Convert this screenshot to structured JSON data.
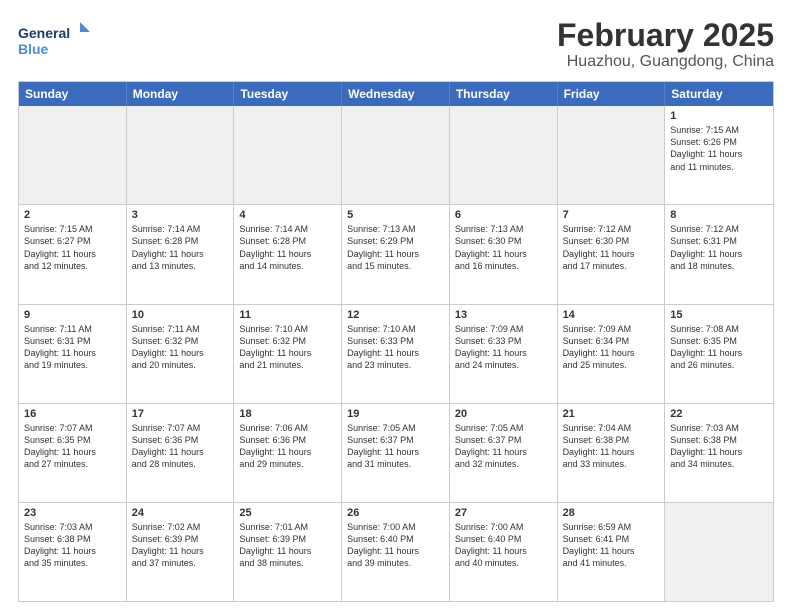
{
  "header": {
    "logo_line1": "General",
    "logo_line2": "Blue",
    "title": "February 2025",
    "subtitle": "Huazhou, Guangdong, China"
  },
  "days_of_week": [
    "Sunday",
    "Monday",
    "Tuesday",
    "Wednesday",
    "Thursday",
    "Friday",
    "Saturday"
  ],
  "weeks": [
    [
      {
        "day": "",
        "text": "",
        "shaded": true
      },
      {
        "day": "",
        "text": "",
        "shaded": true
      },
      {
        "day": "",
        "text": "",
        "shaded": true
      },
      {
        "day": "",
        "text": "",
        "shaded": true
      },
      {
        "day": "",
        "text": "",
        "shaded": true
      },
      {
        "day": "",
        "text": "",
        "shaded": true
      },
      {
        "day": "1",
        "text": "Sunrise: 7:15 AM\nSunset: 6:26 PM\nDaylight: 11 hours\nand 11 minutes.",
        "shaded": false
      }
    ],
    [
      {
        "day": "2",
        "text": "Sunrise: 7:15 AM\nSunset: 6:27 PM\nDaylight: 11 hours\nand 12 minutes.",
        "shaded": false
      },
      {
        "day": "3",
        "text": "Sunrise: 7:14 AM\nSunset: 6:28 PM\nDaylight: 11 hours\nand 13 minutes.",
        "shaded": false
      },
      {
        "day": "4",
        "text": "Sunrise: 7:14 AM\nSunset: 6:28 PM\nDaylight: 11 hours\nand 14 minutes.",
        "shaded": false
      },
      {
        "day": "5",
        "text": "Sunrise: 7:13 AM\nSunset: 6:29 PM\nDaylight: 11 hours\nand 15 minutes.",
        "shaded": false
      },
      {
        "day": "6",
        "text": "Sunrise: 7:13 AM\nSunset: 6:30 PM\nDaylight: 11 hours\nand 16 minutes.",
        "shaded": false
      },
      {
        "day": "7",
        "text": "Sunrise: 7:12 AM\nSunset: 6:30 PM\nDaylight: 11 hours\nand 17 minutes.",
        "shaded": false
      },
      {
        "day": "8",
        "text": "Sunrise: 7:12 AM\nSunset: 6:31 PM\nDaylight: 11 hours\nand 18 minutes.",
        "shaded": false
      }
    ],
    [
      {
        "day": "9",
        "text": "Sunrise: 7:11 AM\nSunset: 6:31 PM\nDaylight: 11 hours\nand 19 minutes.",
        "shaded": false
      },
      {
        "day": "10",
        "text": "Sunrise: 7:11 AM\nSunset: 6:32 PM\nDaylight: 11 hours\nand 20 minutes.",
        "shaded": false
      },
      {
        "day": "11",
        "text": "Sunrise: 7:10 AM\nSunset: 6:32 PM\nDaylight: 11 hours\nand 21 minutes.",
        "shaded": false
      },
      {
        "day": "12",
        "text": "Sunrise: 7:10 AM\nSunset: 6:33 PM\nDaylight: 11 hours\nand 23 minutes.",
        "shaded": false
      },
      {
        "day": "13",
        "text": "Sunrise: 7:09 AM\nSunset: 6:33 PM\nDaylight: 11 hours\nand 24 minutes.",
        "shaded": false
      },
      {
        "day": "14",
        "text": "Sunrise: 7:09 AM\nSunset: 6:34 PM\nDaylight: 11 hours\nand 25 minutes.",
        "shaded": false
      },
      {
        "day": "15",
        "text": "Sunrise: 7:08 AM\nSunset: 6:35 PM\nDaylight: 11 hours\nand 26 minutes.",
        "shaded": false
      }
    ],
    [
      {
        "day": "16",
        "text": "Sunrise: 7:07 AM\nSunset: 6:35 PM\nDaylight: 11 hours\nand 27 minutes.",
        "shaded": false
      },
      {
        "day": "17",
        "text": "Sunrise: 7:07 AM\nSunset: 6:36 PM\nDaylight: 11 hours\nand 28 minutes.",
        "shaded": false
      },
      {
        "day": "18",
        "text": "Sunrise: 7:06 AM\nSunset: 6:36 PM\nDaylight: 11 hours\nand 29 minutes.",
        "shaded": false
      },
      {
        "day": "19",
        "text": "Sunrise: 7:05 AM\nSunset: 6:37 PM\nDaylight: 11 hours\nand 31 minutes.",
        "shaded": false
      },
      {
        "day": "20",
        "text": "Sunrise: 7:05 AM\nSunset: 6:37 PM\nDaylight: 11 hours\nand 32 minutes.",
        "shaded": false
      },
      {
        "day": "21",
        "text": "Sunrise: 7:04 AM\nSunset: 6:38 PM\nDaylight: 11 hours\nand 33 minutes.",
        "shaded": false
      },
      {
        "day": "22",
        "text": "Sunrise: 7:03 AM\nSunset: 6:38 PM\nDaylight: 11 hours\nand 34 minutes.",
        "shaded": false
      }
    ],
    [
      {
        "day": "23",
        "text": "Sunrise: 7:03 AM\nSunset: 6:38 PM\nDaylight: 11 hours\nand 35 minutes.",
        "shaded": false
      },
      {
        "day": "24",
        "text": "Sunrise: 7:02 AM\nSunset: 6:39 PM\nDaylight: 11 hours\nand 37 minutes.",
        "shaded": false
      },
      {
        "day": "25",
        "text": "Sunrise: 7:01 AM\nSunset: 6:39 PM\nDaylight: 11 hours\nand 38 minutes.",
        "shaded": false
      },
      {
        "day": "26",
        "text": "Sunrise: 7:00 AM\nSunset: 6:40 PM\nDaylight: 11 hours\nand 39 minutes.",
        "shaded": false
      },
      {
        "day": "27",
        "text": "Sunrise: 7:00 AM\nSunset: 6:40 PM\nDaylight: 11 hours\nand 40 minutes.",
        "shaded": false
      },
      {
        "day": "28",
        "text": "Sunrise: 6:59 AM\nSunset: 6:41 PM\nDaylight: 11 hours\nand 41 minutes.",
        "shaded": false
      },
      {
        "day": "",
        "text": "",
        "shaded": true
      }
    ]
  ]
}
